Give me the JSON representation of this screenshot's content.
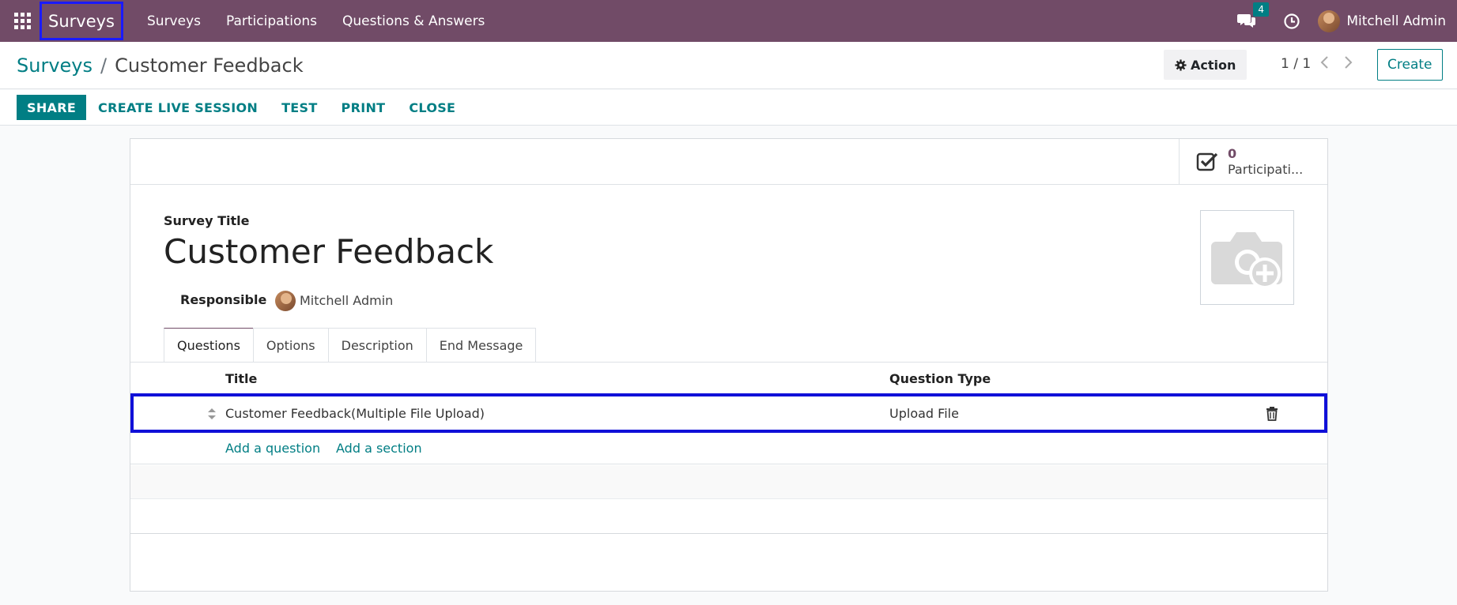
{
  "navbar": {
    "brand": "Surveys",
    "menu": [
      {
        "label": "Surveys"
      },
      {
        "label": "Participations"
      },
      {
        "label": "Questions & Answers"
      }
    ],
    "chat_count": "4",
    "user_name": "Mitchell Admin"
  },
  "control": {
    "breadcrumb_parent": "Surveys",
    "breadcrumb_sep": "/",
    "breadcrumb_current": "Customer Feedback",
    "action_label": "Action",
    "pager": "1 / 1",
    "create_label": "Create"
  },
  "statusbar": {
    "share": "SHARE",
    "buttons": [
      {
        "label": "CREATE LIVE SESSION"
      },
      {
        "label": "TEST"
      },
      {
        "label": "PRINT"
      },
      {
        "label": "CLOSE"
      }
    ]
  },
  "form": {
    "stat_value": "0",
    "stat_label": "Participati...",
    "title_label": "Survey Title",
    "title_value": "Customer Feedback",
    "responsible_label": "Responsible",
    "responsible_value": "Mitchell Admin",
    "tabs": [
      {
        "label": "Questions",
        "active": true
      },
      {
        "label": "Options"
      },
      {
        "label": "Description"
      },
      {
        "label": "End Message"
      }
    ],
    "columns": {
      "title": "Title",
      "type": "Question Type"
    },
    "rows": [
      {
        "title": "Customer Feedback(Multiple File Upload)",
        "type": "Upload File"
      }
    ],
    "add_question": "Add a question",
    "add_section": "Add a section"
  },
  "colors": {
    "brand": "#714b67",
    "accent": "#017e84",
    "highlight": "#1010d8"
  }
}
